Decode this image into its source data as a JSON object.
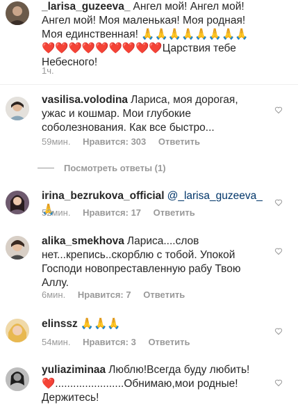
{
  "comments": [
    {
      "username": "_larisa_guzeeva_",
      "text": "Ангел мой! Ангел мой! Ангел мой! Моя маленькая! Моя родная! Моя единственная! 🙏🙏🙏🙏🙏🙏🙏🙏 ❤️❤️❤️❤️❤️❤️❤️❤️❤️Царствия тебе Небесного!",
      "time": "1ч."
    },
    {
      "username": "vasilisa.volodina",
      "text": "Лариса, моя дорогая,  ужас и кошмар. Мои глубокие соболезнования. Как все быстро...",
      "time": "59мин.",
      "likes": "Нравится: 303",
      "reply": "Ответить"
    },
    {
      "username": "irina_bezrukova_official",
      "mention": "@_larisa_guzeeva_",
      "text": "🙏",
      "time": "52мин.",
      "likes": "Нравится: 17",
      "reply": "Ответить"
    },
    {
      "username": "alika_smekhova",
      "text": "Лариса....слов нет...крепись..скорблю с тобой. Упокой Господи новопреставленную рабу Твою Аллу.",
      "time": "6мин.",
      "likes": "Нравится: 7",
      "reply": "Ответить"
    },
    {
      "username": "elinssz",
      "text": "🙏🙏🙏",
      "time": "54мин.",
      "likes": "Нравится: 3",
      "reply": "Ответить"
    },
    {
      "username": "yuliaziminaa",
      "text": "Люблю!Всегда буду любить! ❤️.......................Обнимаю,мои родные! Держитесь!"
    }
  ],
  "view_replies": "Посмотреть ответы (1)",
  "colors": {
    "text": "#262626",
    "meta": "#999999",
    "mention": "#003569"
  }
}
